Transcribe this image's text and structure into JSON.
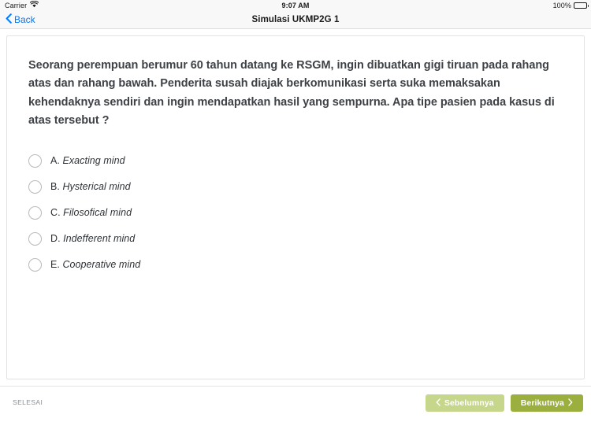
{
  "statusbar": {
    "carrier": "Carrier",
    "wifi_icon": "wifi-icon",
    "time": "9:07 AM",
    "battery_percent": "100%",
    "battery_icon": "battery-full-icon"
  },
  "navbar": {
    "back_label": "Back",
    "back_icon": "chevron-left-icon",
    "title": "Simulasi UKMP2G 1",
    "back_color": "#007aff"
  },
  "question": {
    "text": "Seorang perempuan berumur 60 tahun datang ke RSGM, ingin dibuatkan gigi tiruan pada rahang atas dan rahang bawah. Penderita susah diajak berkomunikasi serta suka memaksakan kehendaknya sendiri dan ingin mendapatkan hasil yang sempurna. Apa tipe pasien pada kasus di atas tersebut ?"
  },
  "options": [
    {
      "letter": "A.",
      "label": "Exacting mind",
      "selected": false
    },
    {
      "letter": "B.",
      "label": "Hysterical mind",
      "selected": false
    },
    {
      "letter": "C.",
      "label": "Filosofical mind",
      "selected": false
    },
    {
      "letter": "D.",
      "label": "Indefferent mind",
      "selected": false
    },
    {
      "letter": "E.",
      "label": "Cooperative mind",
      "selected": false
    }
  ],
  "footer": {
    "finish_label": "SELESAI",
    "prev_label": "Sebelumnya",
    "prev_icon": "chevron-left-icon",
    "prev_color": "#c6d68a",
    "next_label": "Berikutnya",
    "next_icon": "chevron-right-icon",
    "next_color": "#9aaf3e"
  }
}
